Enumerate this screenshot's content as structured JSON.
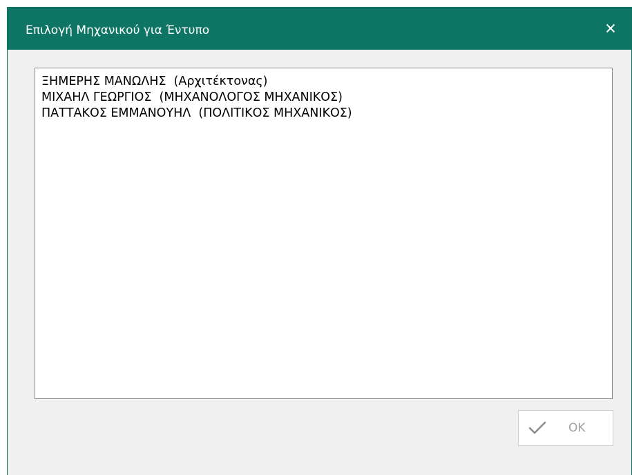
{
  "window": {
    "title": "Επιλογή Μηχανικού για Έντυπο",
    "accent_color": "#0e7564",
    "close_icon": "close-icon"
  },
  "engineers_list": {
    "items": [
      {
        "label": "ΞΗΜΕΡΗΣ ΜΑΝΩΛΗΣ  (Αρχιτέκτονας)"
      },
      {
        "label": "ΜΙΧΑΗΛ ΓΕΩΡΓΙΟΣ  (ΜΗΧΑΝΟΛΟΓΟΣ ΜΗΧΑΝΙΚΟΣ)"
      },
      {
        "label": "ΠΑΤΤΑΚΟΣ ΕΜΜΑΝΟΥΗΛ  (ΠΟΛΙΤΙΚΟΣ ΜΗΧΑΝΙΚΟΣ)"
      }
    ]
  },
  "footer": {
    "ok_label": "OK",
    "ok_icon": "checkmark-icon",
    "ok_enabled": false
  }
}
